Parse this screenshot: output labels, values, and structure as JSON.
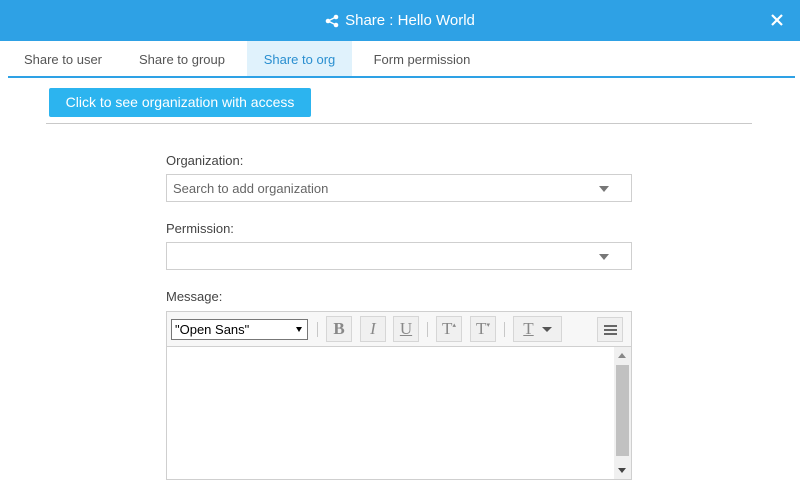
{
  "window": {
    "title": "Share : Hello World",
    "title_icon": "share-icon",
    "close_icon": "close-icon",
    "accent_color": "#2ea1e5"
  },
  "tabs": [
    {
      "label": "Share to user",
      "active": false
    },
    {
      "label": "Share to group",
      "active": false
    },
    {
      "label": "Share to org",
      "active": true
    },
    {
      "label": "Form permission",
      "active": false
    }
  ],
  "access_button": {
    "label": "Click to see organization with access"
  },
  "organization": {
    "label": "Organization:",
    "placeholder": "Search to add organization"
  },
  "permission": {
    "label": "Permission:",
    "value": ""
  },
  "message": {
    "label": "Message:",
    "font_family_value": "\"Open Sans\"",
    "toolbar": {
      "bold": "B",
      "italic": "I",
      "underline": "U",
      "superscript": "T",
      "subscript": "T",
      "text_color": "T"
    },
    "body": ""
  }
}
